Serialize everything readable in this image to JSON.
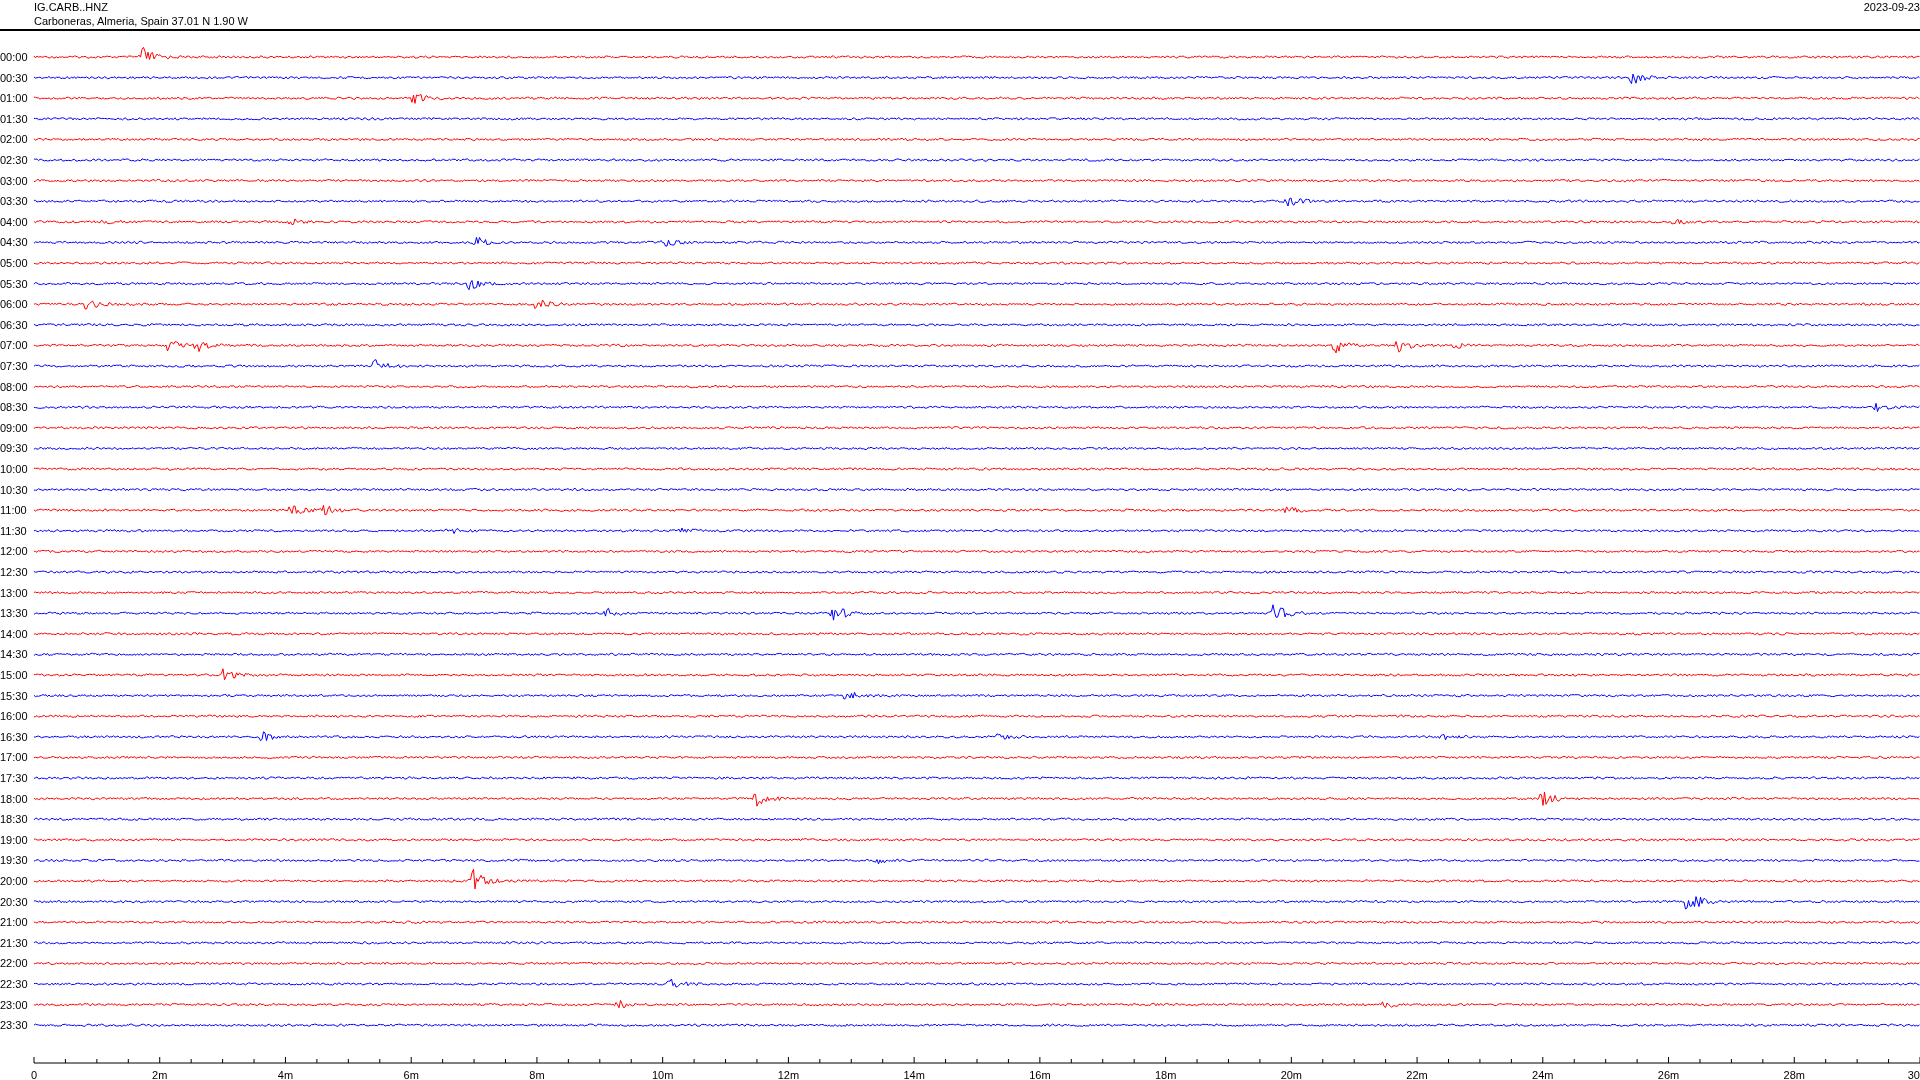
{
  "header": {
    "station": "IG.CARB..HNZ",
    "location": "Carboneras, Almeria, Spain  37.01 N 1.90 W",
    "date": "2023-09-23"
  },
  "rows": [
    {
      "time": "00:00",
      "color": "#ff0000"
    },
    {
      "time": "00:30",
      "color": "#0000ff"
    },
    {
      "time": "01:00",
      "color": "#ff0000"
    },
    {
      "time": "01:30",
      "color": "#0000ff"
    },
    {
      "time": "02:00",
      "color": "#ff0000"
    },
    {
      "time": "02:30",
      "color": "#0000ff"
    },
    {
      "time": "03:00",
      "color": "#ff0000"
    },
    {
      "time": "03:30",
      "color": "#0000ff"
    },
    {
      "time": "04:00",
      "color": "#ff0000"
    },
    {
      "time": "04:30",
      "color": "#0000ff"
    },
    {
      "time": "05:00",
      "color": "#ff0000"
    },
    {
      "time": "05:30",
      "color": "#0000ff"
    },
    {
      "time": "06:00",
      "color": "#ff0000"
    },
    {
      "time": "06:30",
      "color": "#0000ff"
    },
    {
      "time": "07:00",
      "color": "#ff0000"
    },
    {
      "time": "07:30",
      "color": "#0000ff"
    },
    {
      "time": "08:00",
      "color": "#ff0000"
    },
    {
      "time": "08:30",
      "color": "#0000ff"
    },
    {
      "time": "09:00",
      "color": "#ff0000"
    },
    {
      "time": "09:30",
      "color": "#0000ff"
    },
    {
      "time": "10:00",
      "color": "#ff0000"
    },
    {
      "time": "10:30",
      "color": "#0000ff"
    },
    {
      "time": "11:00",
      "color": "#ff0000"
    },
    {
      "time": "11:30",
      "color": "#0000ff"
    },
    {
      "time": "12:00",
      "color": "#ff0000"
    },
    {
      "time": "12:30",
      "color": "#0000ff"
    },
    {
      "time": "13:00",
      "color": "#ff0000"
    },
    {
      "time": "13:30",
      "color": "#0000ff"
    },
    {
      "time": "14:00",
      "color": "#ff0000"
    },
    {
      "time": "14:30",
      "color": "#0000ff"
    },
    {
      "time": "15:00",
      "color": "#ff0000"
    },
    {
      "time": "15:30",
      "color": "#0000ff"
    },
    {
      "time": "16:00",
      "color": "#ff0000"
    },
    {
      "time": "16:30",
      "color": "#0000ff"
    },
    {
      "time": "17:00",
      "color": "#ff0000"
    },
    {
      "time": "17:30",
      "color": "#0000ff"
    },
    {
      "time": "18:00",
      "color": "#ff0000"
    },
    {
      "time": "18:30",
      "color": "#0000ff"
    },
    {
      "time": "19:00",
      "color": "#ff0000"
    },
    {
      "time": "19:30",
      "color": "#0000ff"
    },
    {
      "time": "20:00",
      "color": "#ff0000"
    },
    {
      "time": "20:30",
      "color": "#0000ff"
    },
    {
      "time": "21:00",
      "color": "#ff0000"
    },
    {
      "time": "21:30",
      "color": "#0000ff"
    },
    {
      "time": "22:00",
      "color": "#ff0000"
    },
    {
      "time": "22:30",
      "color": "#0000ff"
    },
    {
      "time": "23:00",
      "color": "#ff0000"
    },
    {
      "time": "23:30",
      "color": "#0000ff"
    }
  ],
  "x_axis": {
    "labels": [
      "0",
      "2m",
      "4m",
      "6m",
      "8m",
      "10m",
      "12m",
      "14m",
      "16m",
      "18m",
      "20m",
      "22m",
      "24m",
      "26m",
      "28m",
      "30"
    ]
  }
}
